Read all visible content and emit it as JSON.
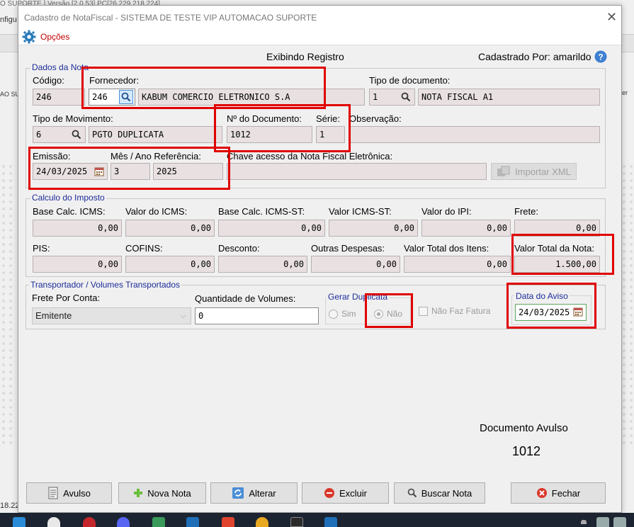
{
  "background": {
    "title": "O SUPORTE ] Versão [2.0.53] PC[26.229.218.224]",
    "menu": "nfigu",
    "left_text": "AO SU",
    "right_text": "per",
    "bottom_text": "18.22"
  },
  "window": {
    "title": "Cadastro de NotaFiscal - SISTEMA DE TESTE VIP AUTOMACAO SUPORTE",
    "close": "✕",
    "menu_options": "Opções"
  },
  "header": {
    "status": "Exibindo Registro",
    "registered_by": "Cadastrado Por: amarildo"
  },
  "dados_nota": {
    "title": "Dados da Nota",
    "codigo_label": "Código:",
    "codigo": "246",
    "fornecedor_label": "Fornecedor:",
    "fornecedor_code": "246",
    "fornecedor_name": "KABUM COMERCIO ELETRONICO S.A",
    "tipo_doc_label": "Tipo de documento:",
    "tipo_doc_code": "1",
    "tipo_doc_name": "NOTA FISCAL A1",
    "tipo_mov_label": "Tipo de Movimento:",
    "tipo_mov_code": "6",
    "tipo_mov_name": "PGTO DUPLICATA",
    "num_doc_label": "Nº do Documento:",
    "num_doc": "1012",
    "serie_label": "Série:",
    "serie": "1",
    "observacao_label": "Observação:",
    "observacao": "",
    "emissao_label": "Emissão:",
    "emissao": "24/03/2025",
    "mes_ano_label": "Mês / Ano Referência:",
    "mes": "3",
    "ano": "2025",
    "chave_label": "Chave acesso da Nota Fiscal Eletrônica:",
    "chave": "",
    "importar_xml": "Importar XML"
  },
  "calculo": {
    "title": "Calculo do Imposto",
    "base_icms_label": "Base Calc. ICMS:",
    "base_icms": "0,00",
    "valor_icms_label": "Valor do ICMS:",
    "valor_icms": "0,00",
    "base_icms_st_label": "Base Calc. ICMS-ST:",
    "base_icms_st": "0,00",
    "valor_icms_st_label": "Valor ICMS-ST:",
    "valor_icms_st": "0,00",
    "valor_ipi_label": "Valor do IPI:",
    "valor_ipi": "0,00",
    "frete_label": "Frete:",
    "frete": "0,00",
    "pis_label": "PIS:",
    "pis": "0,00",
    "cofins_label": "COFINS:",
    "cofins": "0,00",
    "desconto_label": "Desconto:",
    "desconto": "0,00",
    "outras_label": "Outras Despesas:",
    "outras": "0,00",
    "total_itens_label": "Valor Total dos Itens:",
    "total_itens": "0,00",
    "total_nota_label": "Valor Total da Nota:",
    "total_nota": "1.500,00"
  },
  "transportador": {
    "title": "Transportador / Volumes Transportados",
    "frete_conta_label": "Frete Por Conta:",
    "frete_conta": "Emitente",
    "qtd_volumes_label": "Quantidade de  Volumes:",
    "qtd_volumes": "0",
    "gerar_duplicata_title": "Gerar Duplicata",
    "sim": "Sim",
    "nao": "Não",
    "nao_faz_fatura": "Não Faz Fatura",
    "data_aviso_title": "Data do Aviso",
    "data_aviso": "24/03/2025"
  },
  "avulso": {
    "label": "Documento Avulso",
    "number": "1012"
  },
  "buttons": {
    "avulso": "Avulso",
    "nova_nota": "Nova Nota",
    "alterar": "Alterar",
    "excluir": "Excluir",
    "buscar_nota": "Buscar Nota",
    "fechar": "Fechar"
  },
  "colors": {
    "highlight": "#e00000",
    "group_title": "#1c2c99",
    "menu_label": "#c00000",
    "field_bg": "#e9e1e1"
  }
}
